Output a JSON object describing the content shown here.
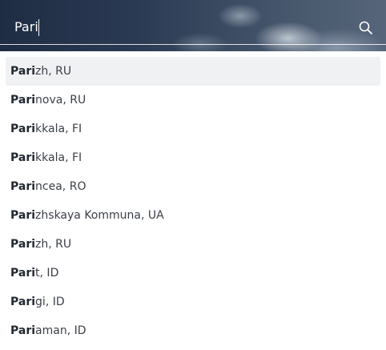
{
  "search": {
    "query": "Pari",
    "icon": "search-icon"
  },
  "results": [
    {
      "match": "Pari",
      "rest": "zh, RU"
    },
    {
      "match": "Pari",
      "rest": "nova, RU"
    },
    {
      "match": "Pari",
      "rest": "kkala, FI"
    },
    {
      "match": "Pari",
      "rest": "kkala, FI"
    },
    {
      "match": "Pari",
      "rest": "ncea, RO"
    },
    {
      "match": "Pari",
      "rest": "zhskaya Kommuna, UA"
    },
    {
      "match": "Pari",
      "rest": "zh, RU"
    },
    {
      "match": "Pari",
      "rest": "t, ID"
    },
    {
      "match": "Pari",
      "rest": "gi, ID"
    },
    {
      "match": "Pari",
      "rest": "aman, ID"
    }
  ],
  "colors": {
    "highlight": "#f0f1f3",
    "text": "#3a3f47",
    "header_dark": "#1f2d44"
  }
}
